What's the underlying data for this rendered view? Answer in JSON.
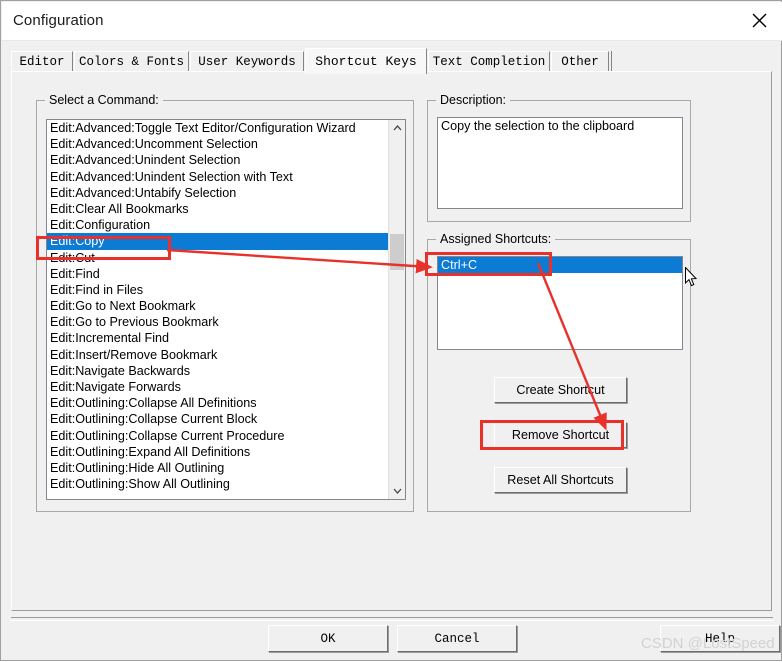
{
  "window": {
    "title": "Configuration",
    "close_icon": "close-icon"
  },
  "tabs": [
    {
      "label": "Editor",
      "selected": false
    },
    {
      "label": "Colors & Fonts",
      "selected": false
    },
    {
      "label": "User Keywords",
      "selected": false
    },
    {
      "label": "Shortcut Keys",
      "selected": true
    },
    {
      "label": "Text Completion",
      "selected": false
    },
    {
      "label": "Other",
      "selected": false
    }
  ],
  "command_group": {
    "legend": "Select a Command:",
    "items": [
      "Edit:Advanced:Toggle Text Editor/Configuration Wizard",
      "Edit:Advanced:Uncomment Selection",
      "Edit:Advanced:Unindent Selection",
      "Edit:Advanced:Unindent Selection with Text",
      "Edit:Advanced:Untabify Selection",
      "Edit:Clear All Bookmarks",
      "Edit:Configuration",
      "Edit:Copy",
      "Edit:Cut",
      "Edit:Find",
      "Edit:Find in Files",
      "Edit:Go to Next Bookmark",
      "Edit:Go to Previous Bookmark",
      "Edit:Incremental Find",
      "Edit:Insert/Remove Bookmark",
      "Edit:Navigate Backwards",
      "Edit:Navigate Forwards",
      "Edit:Outlining:Collapse All Definitions",
      "Edit:Outlining:Collapse Current Block",
      "Edit:Outlining:Collapse Current Procedure",
      "Edit:Outlining:Expand All Definitions",
      "Edit:Outlining:Hide All Outlining",
      "Edit:Outlining:Show All Outlining"
    ],
    "selected_index": 7,
    "scroll_up_icon": "chevron-up-icon",
    "scroll_down_icon": "chevron-down-icon"
  },
  "description_group": {
    "legend": "Description:",
    "text": "Copy the selection to the clipboard"
  },
  "shortcuts_group": {
    "legend": "Assigned Shortcuts:",
    "items": [
      "Ctrl+C"
    ],
    "selected_index": 0,
    "buttons": {
      "create": "Create Shortcut",
      "remove": "Remove Shortcut",
      "reset": "Reset All Shortcuts"
    }
  },
  "dialog_buttons": {
    "ok": "OK",
    "cancel": "Cancel",
    "help": "Help"
  },
  "annotations": {
    "accent_color": "#e8312a",
    "highlight_color": "#0b7bd4",
    "watermark": "CSDN @LostSpeed"
  }
}
